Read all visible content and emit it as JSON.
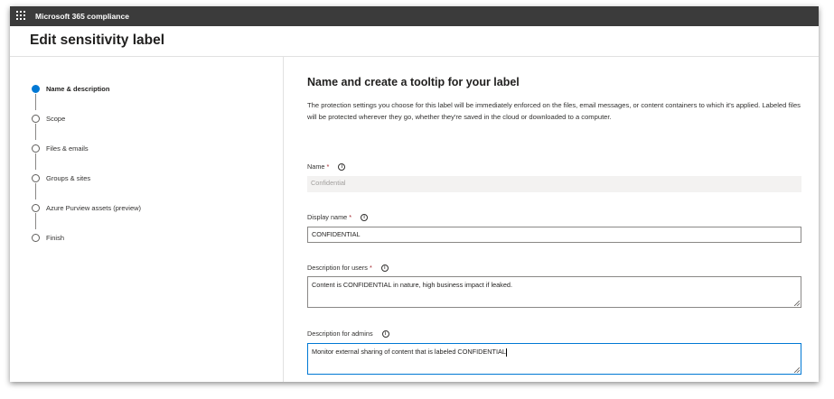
{
  "app": {
    "name": "Microsoft 365 compliance"
  },
  "header": {
    "title": "Edit sensitivity label"
  },
  "steps": [
    {
      "label": "Name & description",
      "active": true
    },
    {
      "label": "Scope",
      "active": false
    },
    {
      "label": "Files & emails",
      "active": false
    },
    {
      "label": "Groups & sites",
      "active": false
    },
    {
      "label": "Azure Purview assets (preview)",
      "active": false
    },
    {
      "label": "Finish",
      "active": false
    }
  ],
  "main": {
    "title": "Name and create a tooltip for your label",
    "intro": "The protection settings you choose for this label will be immediately enforced on the files, email messages, or content containers to which it's applied. Labeled files will be protected wherever they go, whether they're saved in the cloud or downloaded to a computer."
  },
  "fields": {
    "name": {
      "label": "Name",
      "required_mark": "*",
      "value": "Confidential"
    },
    "display_name": {
      "label": "Display name",
      "required_mark": "*",
      "value": "CONFIDENTIAL"
    },
    "description_users": {
      "label": "Description for users",
      "required_mark": "*",
      "value": "Content is CONFIDENTIAL in nature, high business impact if leaked."
    },
    "description_admins": {
      "label": "Description for admins",
      "value": "Monitor external sharing of content that is labeled CONFIDENTIAL"
    }
  },
  "colors": {
    "topbar": "#3b3b3b",
    "accent": "#0078d4",
    "required": "#a4262c"
  },
  "icons": {
    "app_launcher": "waffle-icon",
    "info": "info-icon"
  }
}
